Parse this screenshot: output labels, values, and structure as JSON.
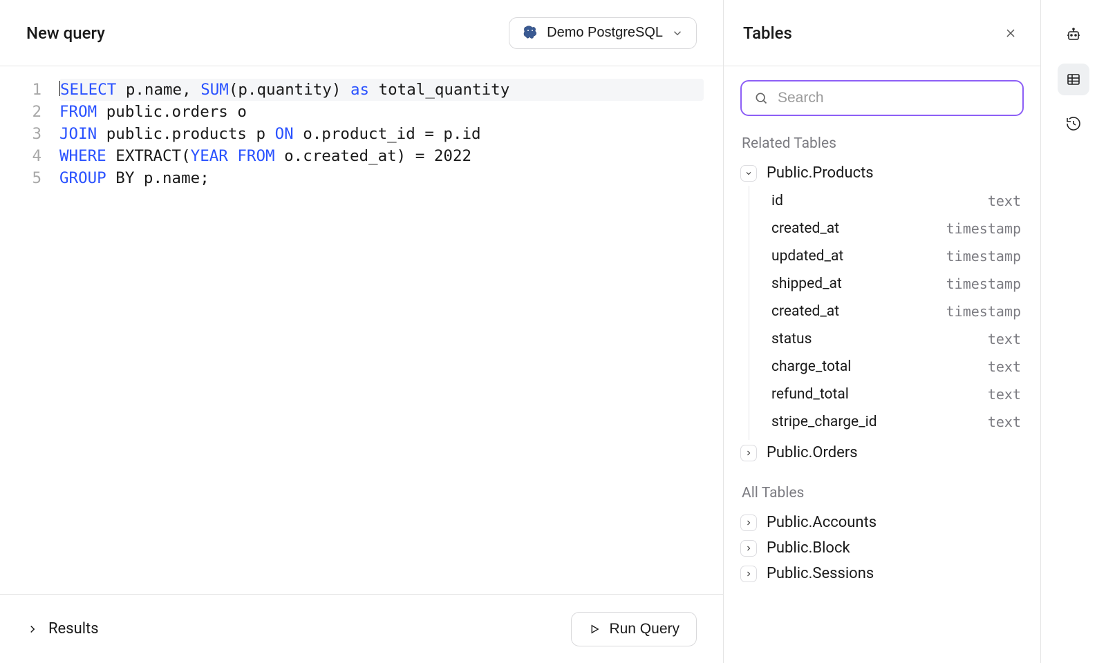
{
  "header": {
    "title": "New query",
    "db_label": "Demo PostgreSQL"
  },
  "editor": {
    "lines": [
      {
        "n": 1,
        "tokens": [
          {
            "t": "SELECT",
            "k": true
          },
          {
            "t": " p.name, "
          },
          {
            "t": "SUM",
            "k": true
          },
          {
            "t": "(p.quantity) "
          },
          {
            "t": "as",
            "k": true
          },
          {
            "t": " total_quantity"
          }
        ],
        "active": true
      },
      {
        "n": 2,
        "tokens": [
          {
            "t": "FROM",
            "k": true
          },
          {
            "t": " public.orders o"
          }
        ]
      },
      {
        "n": 3,
        "tokens": [
          {
            "t": "JOIN",
            "k": true
          },
          {
            "t": " public.products p "
          },
          {
            "t": "ON",
            "k": true
          },
          {
            "t": " o.product_id = p.id"
          }
        ]
      },
      {
        "n": 4,
        "tokens": [
          {
            "t": "WHERE",
            "k": true
          },
          {
            "t": " EXTRACT("
          },
          {
            "t": "YEAR FROM",
            "k": true
          },
          {
            "t": " o.created_at) = 2022"
          }
        ]
      },
      {
        "n": 5,
        "tokens": [
          {
            "t": "GROUP",
            "k": true
          },
          {
            "t": " BY p.name;"
          }
        ]
      }
    ]
  },
  "results": {
    "label": "Results",
    "run_label": "Run Query"
  },
  "side": {
    "title": "Tables",
    "search_placeholder": "Search",
    "related_label": "Related Tables",
    "all_label": "All Tables",
    "related": [
      {
        "name": "Public.Products",
        "expanded": true,
        "columns": [
          {
            "name": "id",
            "type": "text"
          },
          {
            "name": "created_at",
            "type": "timestamp"
          },
          {
            "name": "updated_at",
            "type": "timestamp"
          },
          {
            "name": "shipped_at",
            "type": "timestamp"
          },
          {
            "name": "created_at",
            "type": "timestamp"
          },
          {
            "name": "status",
            "type": "text"
          },
          {
            "name": "charge_total",
            "type": "text"
          },
          {
            "name": "refund_total",
            "type": "text"
          },
          {
            "name": "stripe_charge_id",
            "type": "text"
          }
        ]
      },
      {
        "name": "Public.Orders",
        "expanded": false
      }
    ],
    "all": [
      {
        "name": "Public.Accounts"
      },
      {
        "name": "Public.Block"
      },
      {
        "name": "Public.Sessions"
      }
    ]
  }
}
